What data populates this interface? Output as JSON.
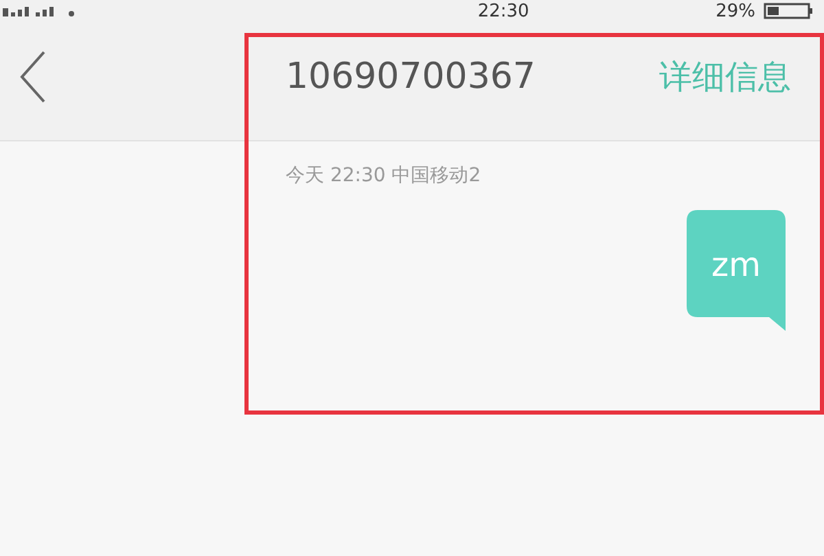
{
  "status_bar": {
    "time": "22:30",
    "battery": "29%"
  },
  "header": {
    "title": "10690700367",
    "action": "详细信息"
  },
  "conversation": {
    "timestamp": "今天  22:30  中国移动2",
    "messages": [
      {
        "text": "zm",
        "outgoing": true
      }
    ]
  },
  "annotation": {
    "kind": "highlight",
    "color": "#e8343f"
  }
}
